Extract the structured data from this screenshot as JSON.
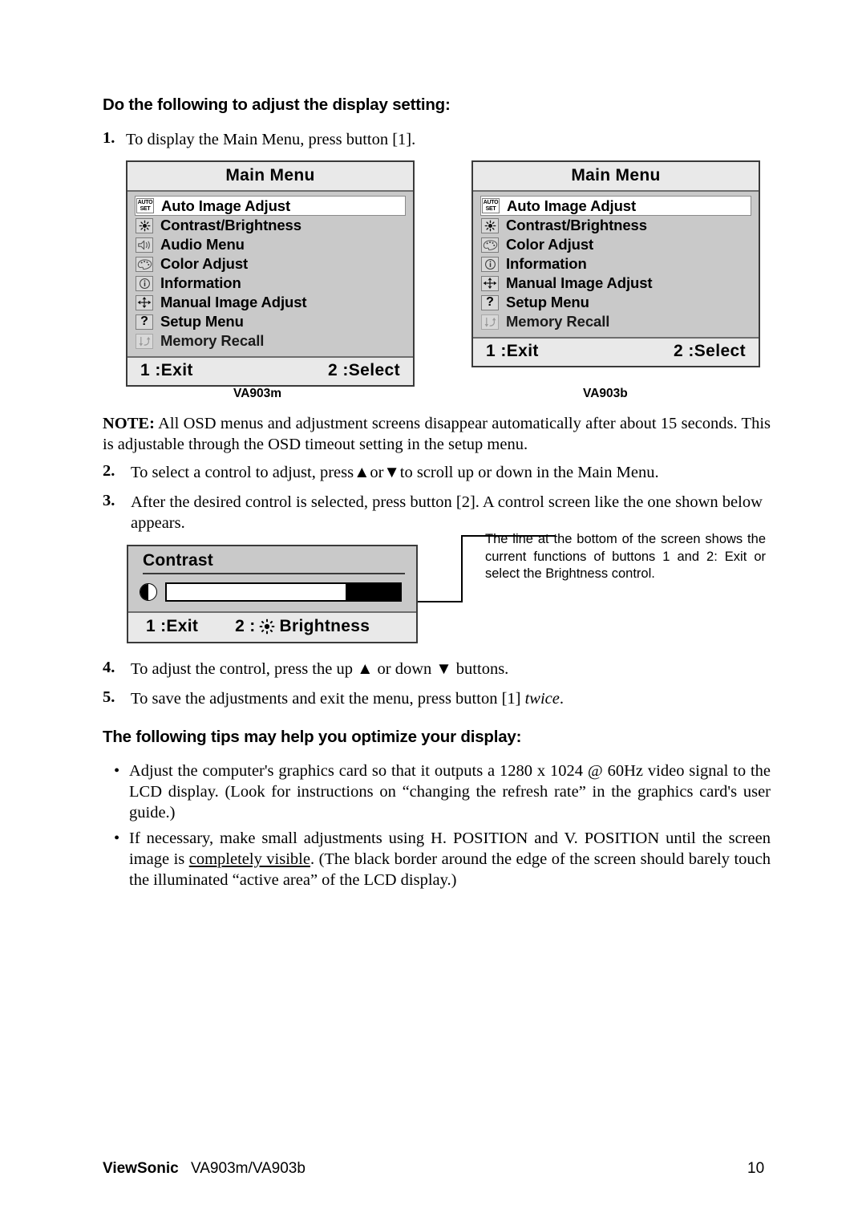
{
  "headings": {
    "adjust_display": "Do the following to adjust the display setting:",
    "tips": "The following tips may help you optimize your display:"
  },
  "steps": [
    {
      "num": "1.",
      "text": "To display the Main Menu, press button [1]."
    },
    {
      "num": "2.",
      "text": "To select a control to adjust, press▲or▼to scroll up or down in the Main Menu."
    },
    {
      "num": "3.",
      "text": "After the desired control is selected, press button [2]. A control screen like the one shown below appears."
    },
    {
      "num": "4.",
      "text": "To adjust the control, press the up ▲ or down ▼ buttons."
    },
    {
      "num": "5.",
      "text": "To save the adjustments and exit the menu, press button [1] twice."
    }
  ],
  "step5": {
    "lead": "To save the adjustments and exit the menu, press button [1] ",
    "italic": "twice",
    "tail": "."
  },
  "note": {
    "label": "NOTE:",
    "text": " All OSD menus and adjustment screens disappear automatically after about 15 seconds. This is adjustable through the OSD timeout setting in the setup menu."
  },
  "osd_left": {
    "caption": "VA903m",
    "title": "Main Menu",
    "items": [
      {
        "label": "Auto Image Adjust",
        "icon": "auto-set-icon",
        "selected": true
      },
      {
        "label": "Contrast/Brightness",
        "icon": "brightness-sun-icon",
        "selected": false
      },
      {
        "label": "Audio Menu",
        "icon": "speaker-icon",
        "selected": false
      },
      {
        "label": "Color Adjust",
        "icon": "color-palette-icon",
        "selected": false
      },
      {
        "label": "Information",
        "icon": "information-icon",
        "selected": false
      },
      {
        "label": "Manual Image Adjust",
        "icon": "move-arrows-icon",
        "selected": false
      },
      {
        "label": "Setup Menu",
        "icon": "question-mark-icon",
        "selected": false
      },
      {
        "label": "Memory Recall",
        "icon": "memory-recall-icon",
        "selected": false
      }
    ],
    "footer_left": "1 :Exit",
    "footer_right": "2 :Select"
  },
  "osd_right": {
    "caption": "VA903b",
    "title": "Main Menu",
    "items": [
      {
        "label": "Auto Image Adjust",
        "icon": "auto-set-icon",
        "selected": true
      },
      {
        "label": "Contrast/Brightness",
        "icon": "brightness-sun-icon",
        "selected": false
      },
      {
        "label": "Color Adjust",
        "icon": "color-palette-icon",
        "selected": false
      },
      {
        "label": "Information",
        "icon": "information-icon",
        "selected": false
      },
      {
        "label": "Manual Image Adjust",
        "icon": "move-arrows-icon",
        "selected": false
      },
      {
        "label": "Setup Menu",
        "icon": "question-mark-icon",
        "selected": false
      },
      {
        "label": "Memory Recall",
        "icon": "memory-recall-icon",
        "selected": false
      }
    ],
    "footer_left": "1 :Exit",
    "footer_right": "2 :Select"
  },
  "contrast_screen": {
    "title": "Contrast",
    "slider_percent": 77,
    "footer_exit": "1 :Exit",
    "footer_button": "2 :",
    "footer_label": "Brightness"
  },
  "callout": {
    "text": "The line at the bottom of the screen shows the current functions of buttons 1 and 2: Exit or select the Brightness control."
  },
  "tips": [
    "Adjust the computer's graphics card so that it outputs a 1280 x 1024 @ 60Hz video signal to the LCD display. (Look for instructions on “changing the refresh rate” in the graphics card's user guide.)",
    "If necessary, make small adjustments using H. POSITION and V. POSITION until the screen image is completely visible. (The black border around the edge of the screen should barely touch the illuminated “active area” of the LCD display.)"
  ],
  "tip2": {
    "part1": "If necessary, make small adjustments using H. POSITION and V. POSITION until the screen image is ",
    "underlined": "completely visible",
    "part2": ". (The black border around the edge of the screen should barely touch the illuminated “active area” of the LCD display.)"
  },
  "bullet_char": "•",
  "footer": {
    "brand": "ViewSonic",
    "model": "VA903m/VA903b",
    "page": "10"
  },
  "colors": {
    "osd_body": "#c9c9c9",
    "osd_bar": "#e9e9e9",
    "osd_border": "#3a3a3a",
    "highlight": "#ffffff"
  }
}
